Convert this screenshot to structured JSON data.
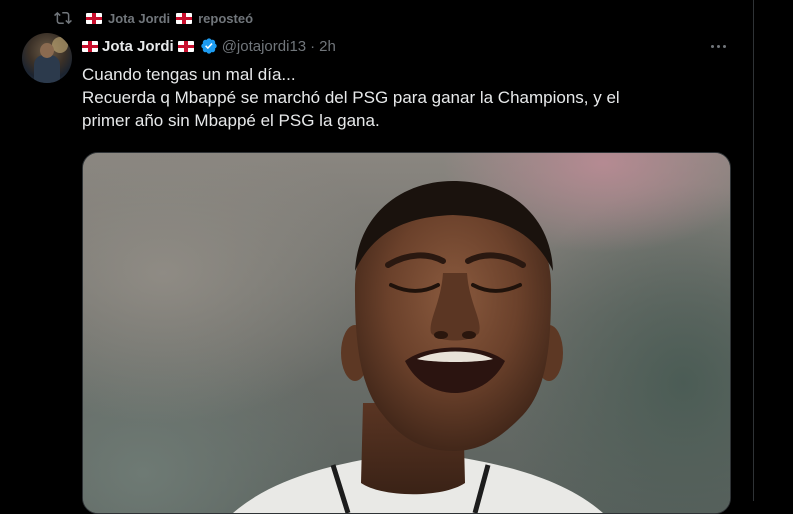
{
  "repost": {
    "icon": "repost-icon",
    "user": "Jota Jordi",
    "label": "reposteó"
  },
  "tweet": {
    "author": {
      "display_name": "Jota Jordi",
      "handle": "@jotajordi13",
      "verified": true
    },
    "separator": "·",
    "time": "2h",
    "text_lines": [
      "Cuando tengas un mal día...",
      "Recuerda q Mbappé se marchó del PSG para ganar la Champions, y el",
      "primer año sin Mbappé el PSG la gana."
    ]
  },
  "colors": {
    "background": "#000000",
    "text": "#e7e9ea",
    "secondary": "#71767b",
    "verified": "#1d9bf0",
    "border": "#2f3336"
  }
}
